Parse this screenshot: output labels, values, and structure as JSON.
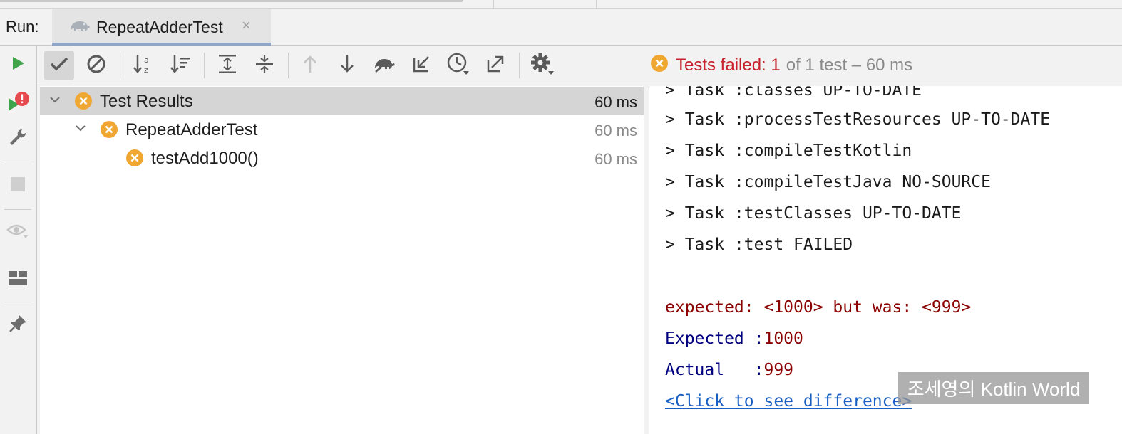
{
  "tabbar": {
    "run_label": "Run:",
    "tab_title": "RepeatAdderTest",
    "tab_close": "×"
  },
  "status": {
    "prefix": "Tests failed: 1",
    "suffix": "of 1 test – 60 ms",
    "color": "#c7222d"
  },
  "tree": {
    "rows": [
      {
        "label": "Test Results",
        "time": "60 ms",
        "expanded": true,
        "status": "failed"
      },
      {
        "label": "RepeatAdderTest",
        "time": "60 ms",
        "expanded": true,
        "status": "failed"
      },
      {
        "label": "testAdd1000()",
        "time": "60 ms",
        "status": "failed"
      }
    ]
  },
  "console": {
    "lines": [
      "> Task :classes UP-TO-DATE",
      "> Task :processTestResources UP-TO-DATE",
      "> Task :compileTestKotlin",
      "> Task :compileTestJava NO-SOURCE",
      "> Task :testClasses UP-TO-DATE",
      "> Task :test FAILED"
    ],
    "error_line": "expected: <1000> but was: <999>",
    "expected_label": "Expected :",
    "expected_value": "1000",
    "actual_label": "Actual   :",
    "actual_value": "999",
    "diff_link": "<Click to see difference>"
  },
  "watermark": "조세영의 Kotlin World",
  "icons": {
    "run": "play-icon",
    "rerun_failed": "rerun-failed-icon",
    "settings": "gear-icon",
    "fail": "fail-circle-icon"
  },
  "colors": {
    "fail_orange": "#f0a732",
    "run_green": "#3ea34a",
    "error_red": "#8b0000",
    "link_blue": "#1a5fc4"
  }
}
